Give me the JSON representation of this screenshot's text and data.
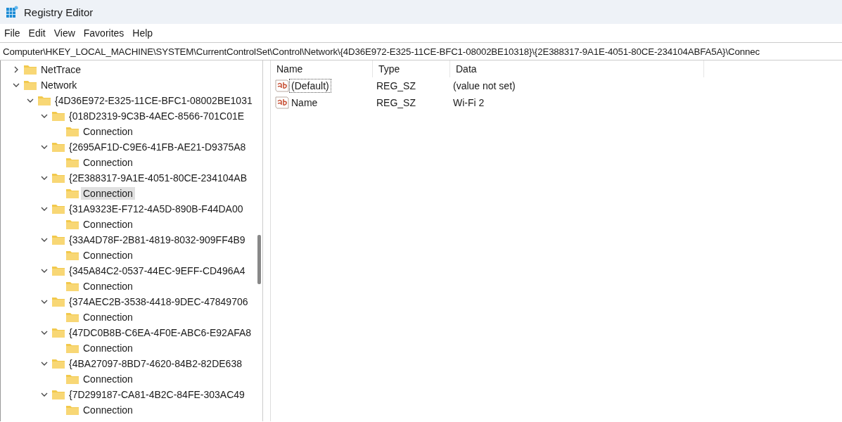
{
  "window": {
    "title": "Registry Editor"
  },
  "menu": [
    "File",
    "Edit",
    "View",
    "Favorites",
    "Help"
  ],
  "address": "Computer\\HKEY_LOCAL_MACHINE\\SYSTEM\\CurrentControlSet\\Control\\Network\\{4D36E972-E325-11CE-BFC1-08002BE10318}\\{2E388317-9A1E-4051-80CE-234104ABFA5A}\\Connec",
  "tree": [
    {
      "label": "NetTrace",
      "expanded": false,
      "selected": false
    },
    {
      "label": "Network",
      "expanded": true,
      "selected": false,
      "children": [
        {
          "label": "{4D36E972-E325-11CE-BFC1-08002BE1031",
          "expanded": true,
          "selected": false,
          "children": [
            {
              "label": "{018D2319-9C3B-4AEC-8566-701C01E",
              "expanded": true,
              "selected": false,
              "children": [
                {
                  "label": "Connection",
                  "selected": false
                }
              ]
            },
            {
              "label": "{2695AF1D-C9E6-41FB-AE21-D9375A8",
              "expanded": true,
              "selected": false,
              "children": [
                {
                  "label": "Connection",
                  "selected": false
                }
              ]
            },
            {
              "label": "{2E388317-9A1E-4051-80CE-234104AB",
              "expanded": true,
              "selected": false,
              "children": [
                {
                  "label": "Connection",
                  "selected": true
                }
              ]
            },
            {
              "label": "{31A9323E-F712-4A5D-890B-F44DA00",
              "expanded": true,
              "selected": false,
              "children": [
                {
                  "label": "Connection",
                  "selected": false
                }
              ]
            },
            {
              "label": "{33A4D78F-2B81-4819-8032-909FF4B9",
              "expanded": true,
              "selected": false,
              "children": [
                {
                  "label": "Connection",
                  "selected": false
                }
              ]
            },
            {
              "label": "{345A84C2-0537-44EC-9EFF-CD496A4",
              "expanded": true,
              "selected": false,
              "children": [
                {
                  "label": "Connection",
                  "selected": false
                }
              ]
            },
            {
              "label": "{374AEC2B-3538-4418-9DEC-47849706",
              "expanded": true,
              "selected": false,
              "children": [
                {
                  "label": "Connection",
                  "selected": false
                }
              ]
            },
            {
              "label": "{47DC0B8B-C6EA-4F0E-ABC6-E92AFA8",
              "expanded": true,
              "selected": false,
              "children": [
                {
                  "label": "Connection",
                  "selected": false
                }
              ]
            },
            {
              "label": "{4BA27097-8BD7-4620-84B2-82DE638",
              "expanded": true,
              "selected": false,
              "children": [
                {
                  "label": "Connection",
                  "selected": false
                }
              ]
            },
            {
              "label": "{7D299187-CA81-4B2C-84FE-303AC49",
              "expanded": true,
              "selected": false,
              "children": [
                {
                  "label": "Connection",
                  "selected": false
                }
              ]
            }
          ]
        }
      ]
    }
  ],
  "values": {
    "columns": [
      "Name",
      "Type",
      "Data"
    ],
    "rows": [
      {
        "name": "(Default)",
        "type": "REG_SZ",
        "data": "(value not set)",
        "focused": true
      },
      {
        "name": "Name",
        "type": "REG_SZ",
        "data": "Wi-Fi 2",
        "focused": false
      }
    ]
  }
}
